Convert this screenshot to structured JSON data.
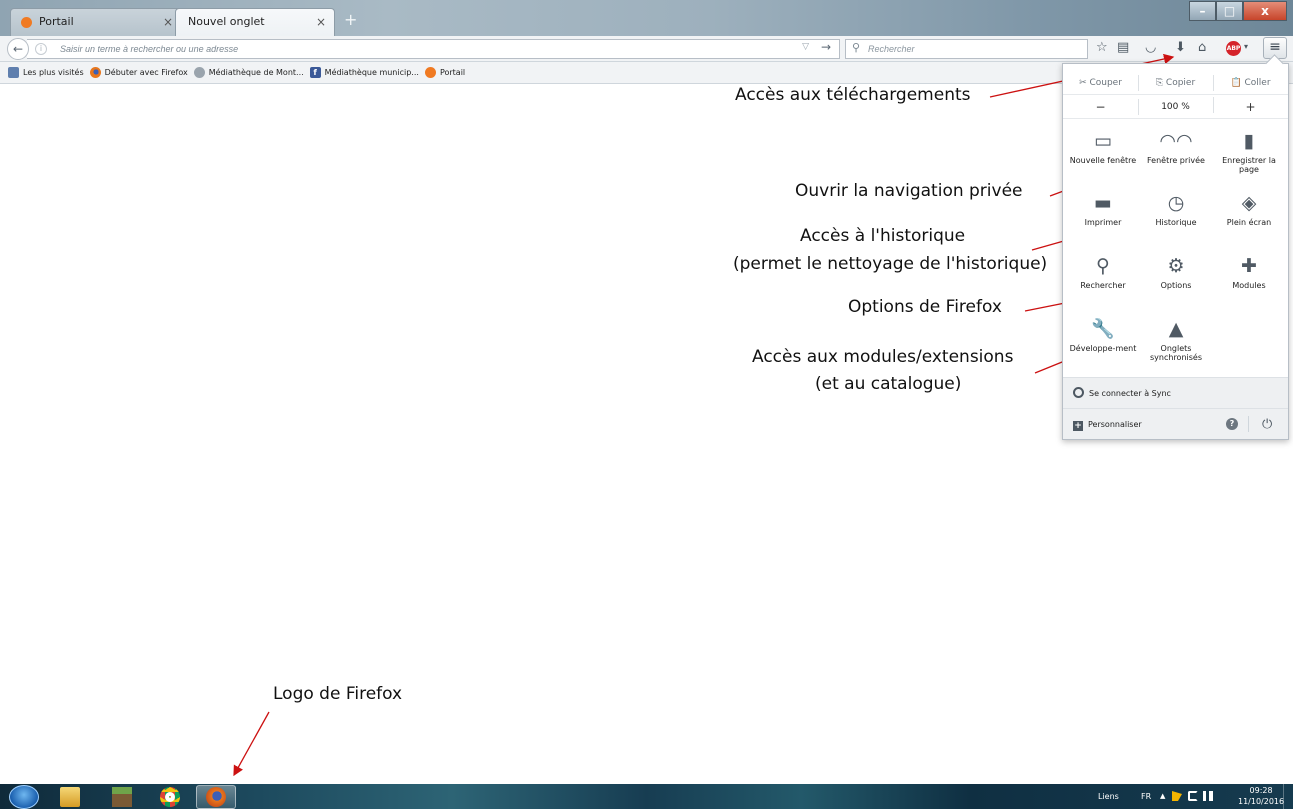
{
  "tabs": [
    {
      "label": "Portail",
      "active": false
    },
    {
      "label": "Nouvel onglet",
      "active": true
    }
  ],
  "icons": {
    "tab_close": "×",
    "new_tab": "+",
    "minimize": "–",
    "maximize": "□",
    "close": "x",
    "back": "←",
    "info": "i",
    "dropdown": "▽",
    "go": "→",
    "search": "⚲",
    "bookmark_star": "☆",
    "bookmarks_list": "▤",
    "pocket": "◡",
    "downloads": "⬇",
    "home": "⌂",
    "adblock": "ABP",
    "abp_drop": "▾",
    "menu": "≡",
    "customize": "+",
    "help": "?",
    "power": "⏻"
  },
  "urlbar": {
    "placeholder": "Saisir un terme à rechercher ou une adresse"
  },
  "searchbar": {
    "placeholder": "Rechercher"
  },
  "bookmarks": [
    {
      "label": "Les plus visités",
      "color": "#5f7fae"
    },
    {
      "label": "Débuter avec Firefox",
      "color": "#e66000"
    },
    {
      "label": "Médiathèque de Mont...",
      "color": "#7c8892"
    },
    {
      "label": "Médiathèque municip...",
      "color": "#3b5998"
    },
    {
      "label": "Portail",
      "color": "#f07a22"
    }
  ],
  "menu_panel": {
    "edit": [
      "Couper",
      "Copier",
      "Coller"
    ],
    "zoom": {
      "minus": "−",
      "level": "100 %",
      "plus": "+"
    },
    "items": [
      {
        "label": "Nouvelle fenêtre",
        "icon": "▭"
      },
      {
        "label": "Fenêtre privée",
        "icon": "◠◠"
      },
      {
        "label": "Enregistrer la page",
        "icon": "▮"
      },
      {
        "label": "Imprimer",
        "icon": "▬"
      },
      {
        "label": "Historique",
        "icon": "◷"
      },
      {
        "label": "Plein écran",
        "icon": "◈"
      },
      {
        "label": "Rechercher",
        "icon": "⚲"
      },
      {
        "label": "Options",
        "icon": "⚙"
      },
      {
        "label": "Modules",
        "icon": "✚"
      },
      {
        "label": "Développe-ment",
        "icon": "🔧"
      },
      {
        "label": "Onglets synchronisés",
        "icon": "▲"
      }
    ],
    "sync": "Se connecter à Sync",
    "customize": "Personnaliser"
  },
  "annotations": [
    "Accès aux téléchargements",
    "Ouvrir la navigation privée",
    "Accès à l'historique",
    "(permet le nettoyage de l'historique)",
    "Options de Firefox",
    "Accès aux modules/extensions",
    "(et au catalogue)",
    "Logo de Firefox"
  ],
  "annotation_color": "#cc1111",
  "taskbar": {
    "links": "Liens",
    "lang": "FR",
    "up": "▲",
    "time": "09:28",
    "date": "11/10/2016"
  }
}
